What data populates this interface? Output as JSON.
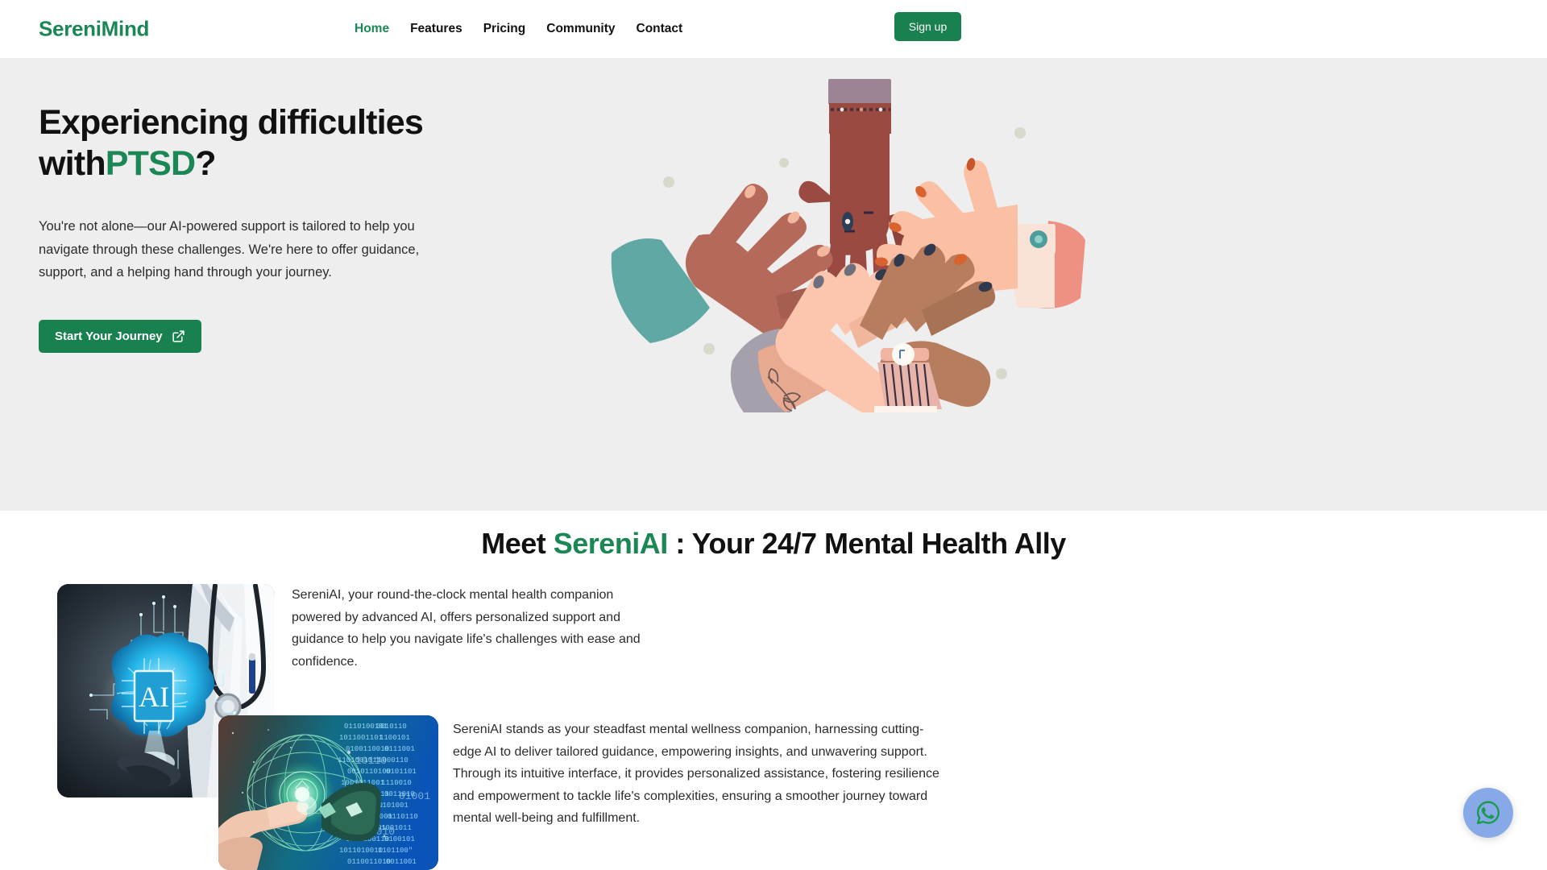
{
  "brand": {
    "name": "SereniMind",
    "accent_color": "#1a8755",
    "button_color": "#18814f"
  },
  "header": {
    "nav": [
      {
        "label": "Home",
        "active": true
      },
      {
        "label": "Features",
        "active": false
      },
      {
        "label": "Pricing",
        "active": false
      },
      {
        "label": "Community",
        "active": false
      },
      {
        "label": "Contact",
        "active": false
      }
    ],
    "signup_label": "Sign up"
  },
  "hero": {
    "title_line1": "Experiencing difficulties",
    "title_line2_prefix": "with",
    "title_line2_accent": "PTSD",
    "title_line2_suffix": "?",
    "subtitle": "You're not alone—our AI-powered support is tailored to help you navigate through these challenges. We're here to offer guidance, support, and a helping hand through your journey.",
    "cta_label": "Start Your Journey",
    "cta_icon": "external-link-icon",
    "illustration": "diverse-hands-stacked-together-illustration",
    "background_color": "#eeeeee"
  },
  "meet": {
    "title_prefix": "Meet ",
    "title_accent": "SereniAI",
    "title_suffix": " : Your 24/7 Mental Health Ally",
    "paragraph_one": "SereniAI, your round-the-clock mental health companion powered by advanced AI, offers personalized support and guidance to help you navigate life's challenges with ease and confidence.",
    "paragraph_two": "SereniAI stands as your steadfast mental wellness companion, harnessing cutting-edge AI to deliver tailored guidance, empowering insights, and unwavering support. Through its intuitive interface, it provides personalized assistance, fostering resilience and empowerment to tackle life's complexities, ensuring a smoother journey toward mental well-being and fulfillment.",
    "image_one": "doctor-holding-ai-brain-hologram",
    "image_two": "hand-touching-holographic-globe-binary-code"
  },
  "floating_action": {
    "icon": "whatsapp-icon",
    "background_color": "#87a9e8",
    "glyph_color": "#1a9b4c"
  }
}
